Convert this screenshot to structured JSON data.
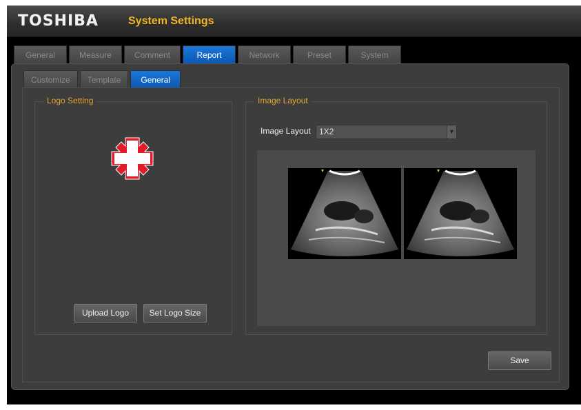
{
  "header": {
    "brand": "TOSHIBA",
    "title": "System Settings"
  },
  "tabs": [
    {
      "label": "General",
      "active": false
    },
    {
      "label": "Measure",
      "active": false
    },
    {
      "label": "Comment",
      "active": false
    },
    {
      "label": "Report",
      "active": true
    },
    {
      "label": "Network",
      "active": false
    },
    {
      "label": "Preset",
      "active": false
    },
    {
      "label": "System",
      "active": false
    }
  ],
  "subtabs": [
    {
      "label": "Customize",
      "active": false
    },
    {
      "label": "Template",
      "active": false
    },
    {
      "label": "General",
      "active": true
    }
  ],
  "logo_setting": {
    "title": "Logo Setting",
    "upload_label": "Upload Logo",
    "size_label": "Set Logo Size"
  },
  "image_layout": {
    "title": "Image Layout",
    "field_label": "Image Layout",
    "value": "1X2"
  },
  "footer": {
    "save_label": "Save"
  },
  "colors": {
    "accent": "#0b58b3",
    "group_title": "#e0a830",
    "logo_red": "#e21b2a"
  }
}
